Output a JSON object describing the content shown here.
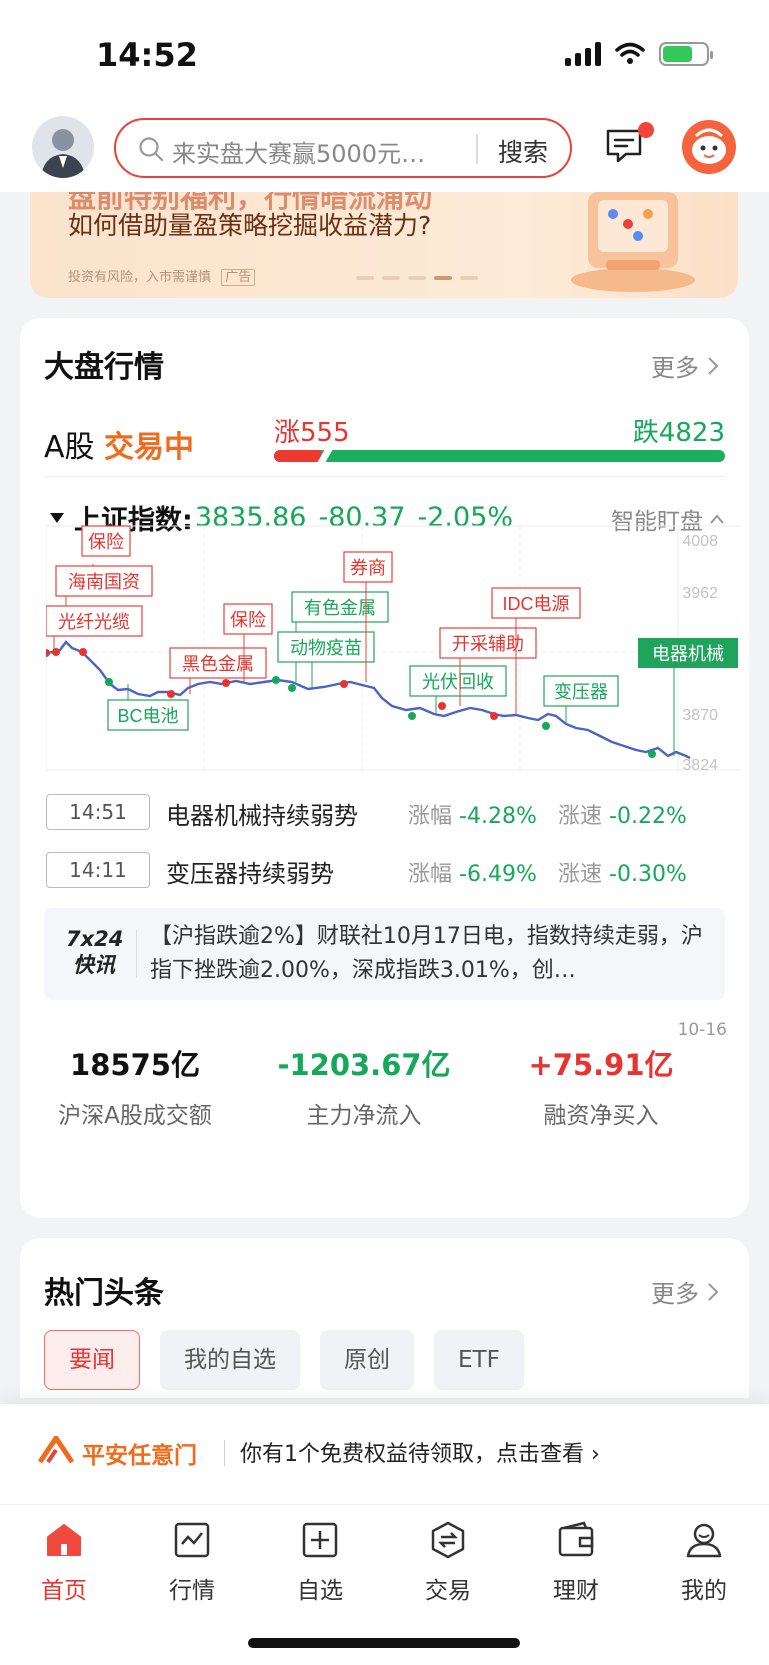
{
  "status_bar": {
    "time": "14:52"
  },
  "header": {
    "search_placeholder": "来实盘大赛赢5000元…",
    "search_button": "搜索"
  },
  "banner": {
    "title_cut": "盘前特别福利，行情暗流涌动",
    "title": "如何借助量盈策略挖掘收益潜力?",
    "note": "投资有风险，入市需谨慎",
    "ad_tag": "广告"
  },
  "market": {
    "title": "大盘行情",
    "more": "更多",
    "a_share": "A股",
    "status": "交易中",
    "rise_label": "涨555",
    "fall_label": "跌4823",
    "rise_count": 555,
    "fall_count": 4823,
    "index_name": "上证指数:",
    "index_value": "3835.86",
    "index_change": "-80.37",
    "index_pct": "-2.05%",
    "smart_watch": "智能盯盘",
    "chart": {
      "y_ticks": [
        "4008",
        "3962",
        "3870",
        "3824"
      ],
      "tags": [
        {
          "text": "保险",
          "color": "red"
        },
        {
          "text": "海南国资",
          "color": "red"
        },
        {
          "text": "光纤光缆",
          "color": "red"
        },
        {
          "text": "黑色金属",
          "color": "red"
        },
        {
          "text": "保险",
          "color": "red"
        },
        {
          "text": "BC电池",
          "color": "green"
        },
        {
          "text": "有色金属",
          "color": "green"
        },
        {
          "text": "动物疫苗",
          "color": "green"
        },
        {
          "text": "券商",
          "color": "red"
        },
        {
          "text": "光伏回收",
          "color": "green"
        },
        {
          "text": "开采辅助",
          "color": "red"
        },
        {
          "text": "IDC电源",
          "color": "red"
        },
        {
          "text": "变压器",
          "color": "green"
        },
        {
          "text": "电器机械",
          "color": "green-solid"
        }
      ]
    },
    "alerts": [
      {
        "time": "14:51",
        "text": "电器机械持续弱势",
        "zf_label": "涨幅",
        "zf": "-4.28%",
        "zs_label": "涨速",
        "zs": "-0.22%"
      },
      {
        "time": "14:11",
        "text": "变压器持续弱势",
        "zf_label": "涨幅",
        "zf": "-6.49%",
        "zs_label": "涨速",
        "zs": "-0.30%"
      }
    ],
    "news": {
      "logo_line1": "7x24",
      "logo_line2": "快讯",
      "text": "【沪指跌逾2%】财联社10月17日电，指数持续走弱，沪指下挫跌逾2.00%，深成指跌3.01%，创…"
    },
    "flow_date": "10-16",
    "flows": [
      {
        "value": "18575亿",
        "label": "沪深A股成交额",
        "color": "#111111"
      },
      {
        "value": "-1203.67亿",
        "label": "主力净流入",
        "color": "#16a85a"
      },
      {
        "value": "+75.91亿",
        "label": "融资净买入",
        "color": "#e8342f"
      }
    ]
  },
  "hot": {
    "title": "热门头条",
    "more": "更多",
    "tabs": [
      "要闻",
      "我的自选",
      "原创",
      "ETF"
    ]
  },
  "promo": {
    "brand": "平安任意门",
    "message": "你有1个免费权益待领取，点击查看 ›"
  },
  "tabbar": [
    {
      "label": "首页",
      "icon": "home-icon"
    },
    {
      "label": "行情",
      "icon": "chart-icon"
    },
    {
      "label": "自选",
      "icon": "add-watchlist-icon"
    },
    {
      "label": "交易",
      "icon": "trade-icon"
    },
    {
      "label": "理财",
      "icon": "wallet-icon"
    },
    {
      "label": "我的",
      "icon": "profile-icon"
    }
  ],
  "colors": {
    "accent": "#e8342f",
    "up": "#e8342f",
    "down": "#16a85a",
    "orange": "#f26b1d"
  }
}
